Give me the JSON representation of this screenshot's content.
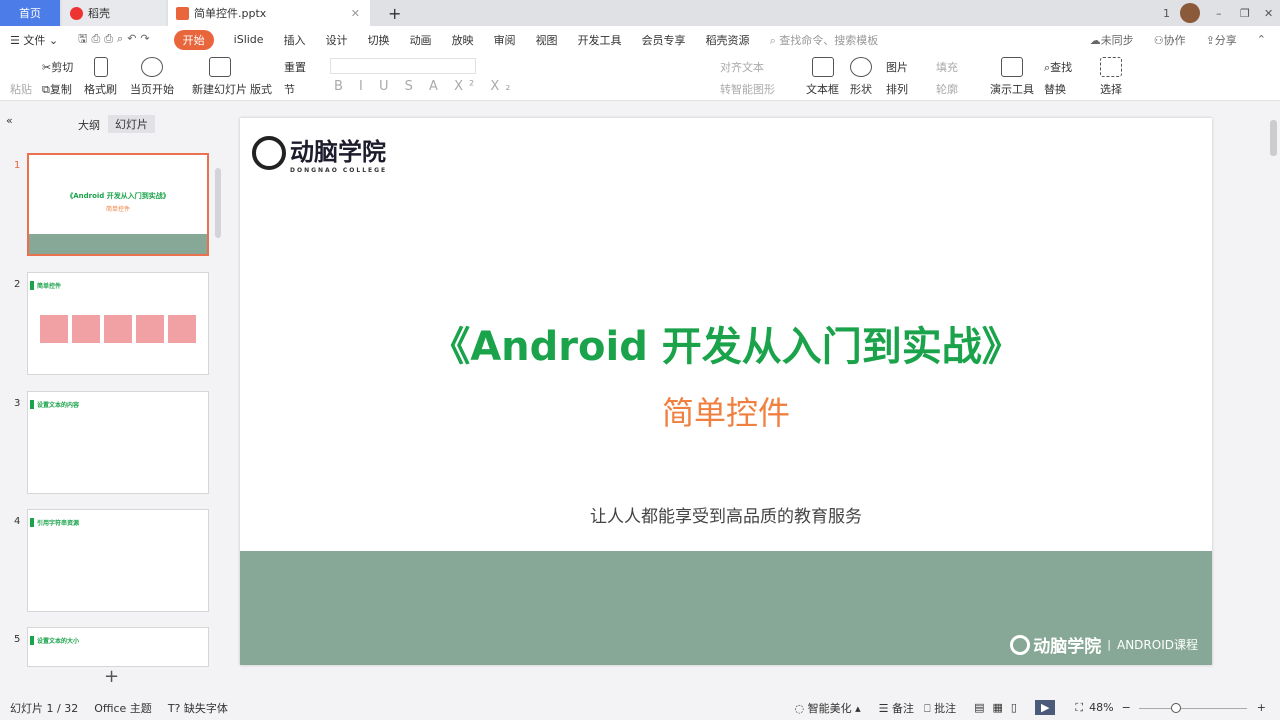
{
  "tabs": {
    "home": "首页",
    "daoke": "稻壳",
    "file": "简单控件.pptx",
    "new_tab": "+"
  },
  "window": {
    "badge": "1",
    "minimize": "–",
    "restore": "❐",
    "close": "✕"
  },
  "menu": {
    "file": "文件",
    "items": [
      "开始",
      "iSlide",
      "插入",
      "设计",
      "切换",
      "动画",
      "放映",
      "审阅",
      "视图",
      "开发工具",
      "会员专享",
      "稻壳资源"
    ],
    "search": "查找命令、搜索模板",
    "sync": "未同步",
    "collab": "协作",
    "share": "分享"
  },
  "toolbar": {
    "paste": "粘贴",
    "cut": "剪切",
    "copy": "复制",
    "format_painter": "格式刷",
    "play_current": "当页开始",
    "new_slide": "新建幻灯片",
    "layout": "版式",
    "section": "节",
    "reset": "重置",
    "align_text": "对齐文本",
    "smart_art": "转智能图形",
    "textbox": "文本框",
    "shape": "形状",
    "picture": "图片",
    "fill": "填充",
    "arrange": "排列",
    "outline": "轮廓",
    "presenter": "演示工具",
    "find": "查找",
    "replace": "替换",
    "select": "选择"
  },
  "panel": {
    "tab_outline": "大纲",
    "tab_slides": "幻灯片",
    "add": "+"
  },
  "thumbnails": [
    {
      "num": "1",
      "title": "《Android 开发从入门到实战》",
      "subtitle": "简单控件"
    },
    {
      "num": "2",
      "title": "简单控件"
    },
    {
      "num": "3",
      "title": "设置文本的内容"
    },
    {
      "num": "4",
      "title": "引用字符串资源"
    },
    {
      "num": "5",
      "title": "设置文本的大小"
    }
  ],
  "slide": {
    "logo": "动脑学院",
    "logo_sub": "DONGNAO COLLEGE",
    "title": "《Android 开发从入门到实战》",
    "subtitle": "简单控件",
    "tagline": "让人人都能享受到高品质的教育服务",
    "footer_logo": "动脑学院",
    "footer_course": "ANDROID课程"
  },
  "status": {
    "slide_count": "幻灯片 1 / 32",
    "theme": "Office 主题",
    "missing_font": "缺失字体",
    "beautify": "智能美化",
    "notes": "备注",
    "comment": "批注",
    "zoom": "48%"
  },
  "colors": {
    "accent": "#e9653c",
    "green": "#1aa34a",
    "orange": "#f08040",
    "band": "#87a896"
  }
}
